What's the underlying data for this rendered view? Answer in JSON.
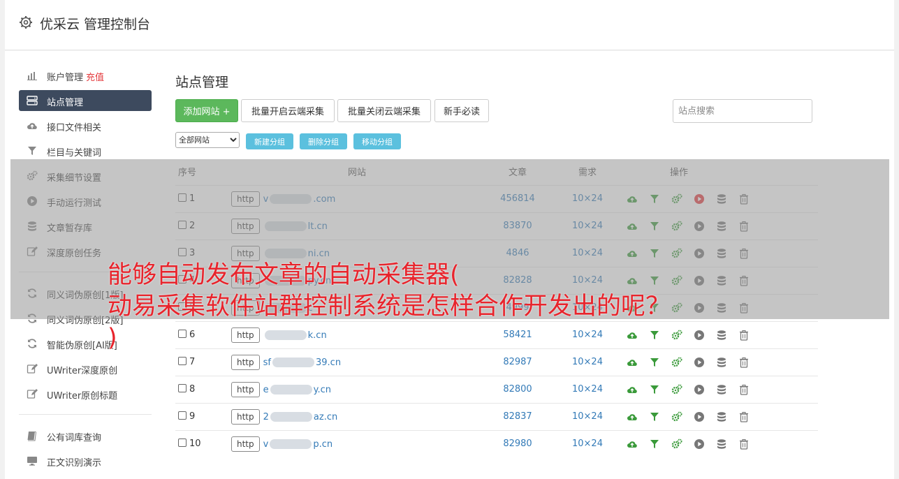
{
  "header": {
    "title": "优采云 管理控制台"
  },
  "sidebar": {
    "groups": [
      [
        {
          "label": "账户管理",
          "badge": "充值",
          "icon": "bar-chart-icon"
        },
        {
          "label": "站点管理",
          "icon": "server-icon",
          "active": true
        },
        {
          "label": "接口文件相关",
          "icon": "cloud-upload-icon"
        },
        {
          "label": "栏目与关键词",
          "icon": "filter-icon"
        },
        {
          "label": "采集细节设置",
          "icon": "cogs-icon"
        },
        {
          "label": "手动运行测试",
          "icon": "play-icon"
        },
        {
          "label": "文章暂存库",
          "icon": "database-icon"
        },
        {
          "label": "深度原创任务",
          "icon": "edit-icon"
        }
      ],
      [
        {
          "label": "同义词伪原创[1版]",
          "icon": "refresh-icon"
        },
        {
          "label": "同义词伪原创[2版]",
          "icon": "refresh-icon"
        },
        {
          "label": "智能伪原创[AI版]",
          "icon": "refresh-icon"
        },
        {
          "label": "UWriter深度原创",
          "icon": "edit-icon"
        },
        {
          "label": "UWriter原创标题",
          "icon": "edit-icon"
        }
      ],
      [
        {
          "label": "公有词库查询",
          "icon": "book-icon"
        },
        {
          "label": "正文识别演示",
          "icon": "monitor-icon"
        }
      ]
    ]
  },
  "main": {
    "title": "站点管理",
    "toolbar": {
      "add_label": "添加网站 +",
      "batch_on_label": "批量开启云端采集",
      "batch_off_label": "批量关闭云端采集",
      "guide_label": "新手必读"
    },
    "search": {
      "placeholder": "站点搜索"
    },
    "group_select": "全部网站",
    "group_buttons": {
      "new": "新建分组",
      "delete": "删除分组",
      "move": "移动分组"
    },
    "table": {
      "headers": [
        "序号",
        "网站",
        "文章",
        "需求",
        "操作"
      ],
      "rows": [
        {
          "no": "1",
          "tag": "http",
          "pre": "v",
          "post": ".com",
          "count": "456814",
          "req": "10×24",
          "play_red": true
        },
        {
          "no": "2",
          "tag": "http",
          "pre": "",
          "post": "lt.cn",
          "count": "83870",
          "req": "10×24"
        },
        {
          "no": "3",
          "tag": "http",
          "pre": "",
          "post": "ni.cn",
          "count": "4846",
          "req": "10×24"
        },
        {
          "no": "4",
          "tag": "http",
          "pre": "",
          "post": "py.cn",
          "count": "82828",
          "req": "10×24"
        },
        {
          "no": "5",
          "tag": "http",
          "pre": "",
          "post": "c",
          "count": "4999",
          "req": "10×24"
        },
        {
          "no": "6",
          "tag": "http",
          "pre": "",
          "post": "k.cn",
          "count": "58421",
          "req": "10×24"
        },
        {
          "no": "7",
          "tag": "http",
          "pre": "sf",
          "post": "39.cn",
          "count": "82987",
          "req": "10×24"
        },
        {
          "no": "8",
          "tag": "http",
          "pre": "e",
          "post": "y.cn",
          "count": "82800",
          "req": "10×24"
        },
        {
          "no": "9",
          "tag": "http",
          "pre": "2",
          "post": "az.cn",
          "count": "82837",
          "req": "10×24"
        },
        {
          "no": "10",
          "tag": "http",
          "pre": "v",
          "post": "p.cn",
          "count": "82980",
          "req": "10×24"
        }
      ]
    }
  },
  "overlay": {
    "line1": "能够自动发布文章的自动采集器(",
    "line2": "动易采集软件站群控制系统是怎样合作开发出的呢？",
    "line3": ")"
  }
}
